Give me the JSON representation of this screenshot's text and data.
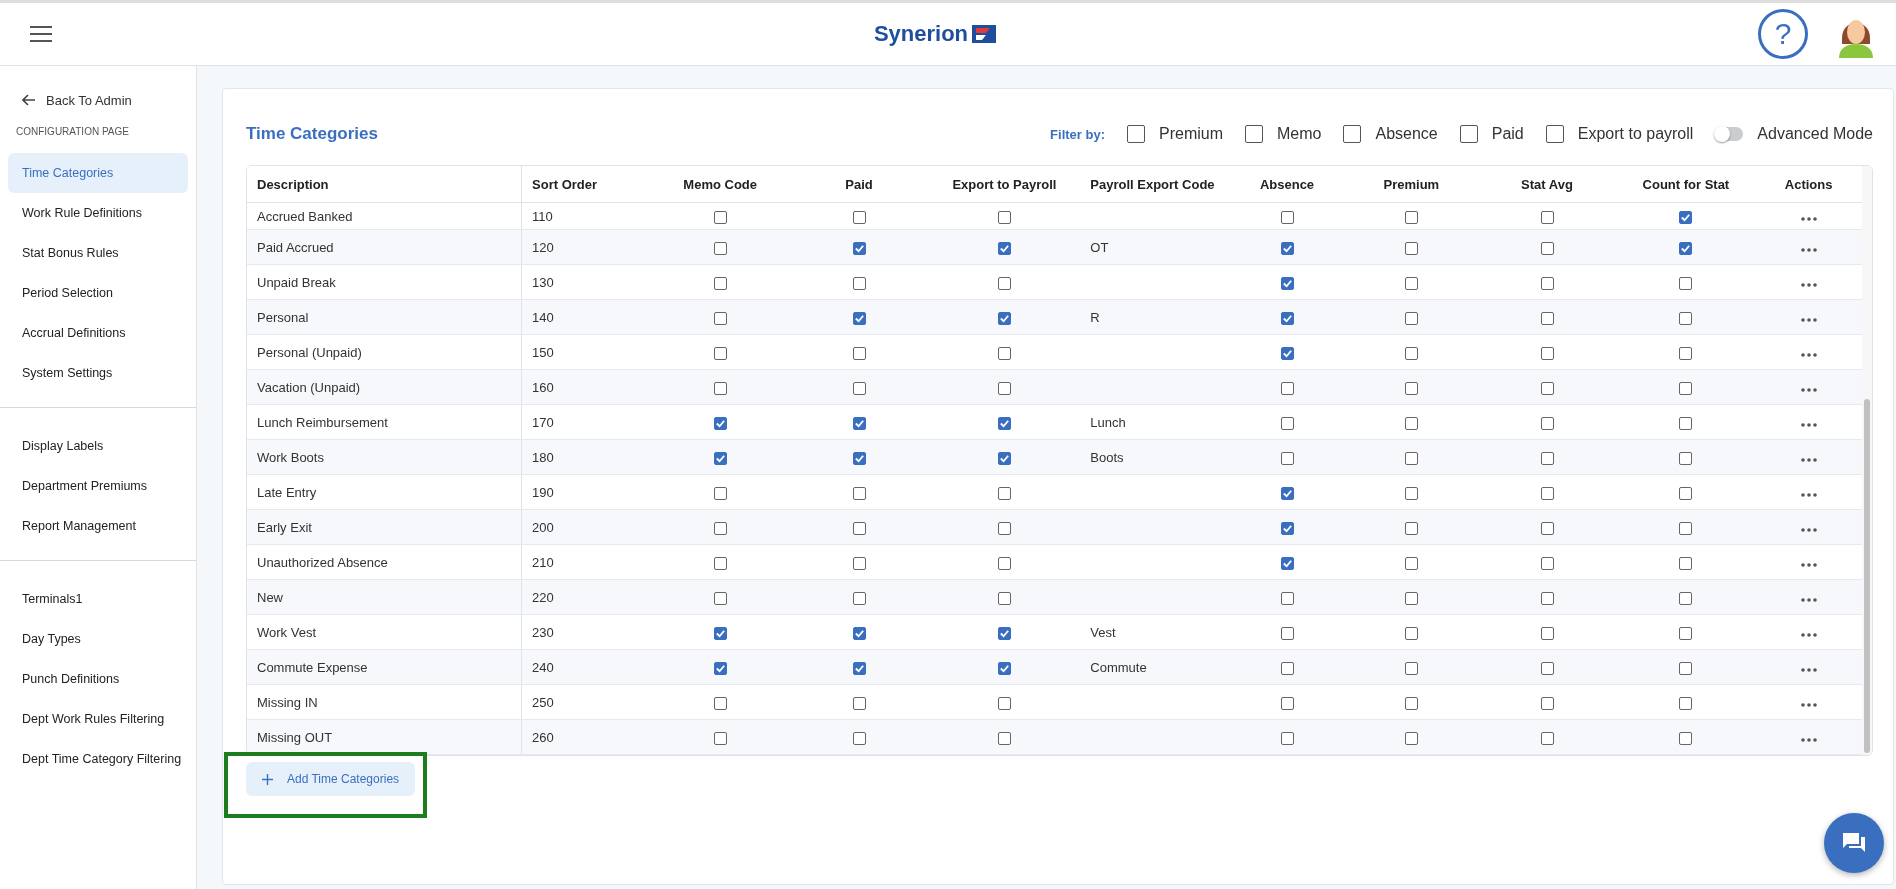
{
  "header": {
    "logo": "Synerion",
    "help_button": "?"
  },
  "sidebar": {
    "back_link": "Back To Admin",
    "section_title": "CONFIGURATION PAGE",
    "groups": [
      {
        "items": [
          {
            "label": "Time Categories",
            "selected": true
          },
          {
            "label": "Work Rule Definitions",
            "selected": false
          },
          {
            "label": "Stat Bonus Rules",
            "selected": false
          },
          {
            "label": "Period Selection",
            "selected": false
          },
          {
            "label": "Accrual Definitions",
            "selected": false
          },
          {
            "label": "System Settings",
            "selected": false
          }
        ]
      },
      {
        "items": [
          {
            "label": "Display Labels",
            "selected": false
          },
          {
            "label": "Department Premiums",
            "selected": false
          },
          {
            "label": "Report Management",
            "selected": false
          }
        ]
      },
      {
        "items": [
          {
            "label": "Terminals1",
            "selected": false
          },
          {
            "label": "Day Types",
            "selected": false
          },
          {
            "label": "Punch Definitions",
            "selected": false
          },
          {
            "label": "Dept Work Rules Filtering",
            "selected": false
          },
          {
            "label": "Dept Time Category Filtering",
            "selected": false
          }
        ]
      }
    ]
  },
  "page_title": "Time Categories",
  "filter": {
    "label": "Filter by:",
    "options": [
      {
        "label": "Premium",
        "checked": false
      },
      {
        "label": "Memo",
        "checked": false
      },
      {
        "label": "Absence",
        "checked": false
      },
      {
        "label": "Paid",
        "checked": false
      },
      {
        "label": "Export to payroll",
        "checked": false
      }
    ],
    "advanced_mode": {
      "label": "Advanced Mode",
      "on": false
    }
  },
  "table": {
    "columns": [
      "Description",
      "Sort Order",
      "Memo Code",
      "Paid",
      "Export to Payroll",
      "Payroll Export Code",
      "Absence",
      "Premium",
      "Stat Avg",
      "Count for Stat",
      "Actions"
    ],
    "rows": [
      {
        "description": "Accrued Banked",
        "sort_order": "110",
        "memo_code": false,
        "paid": false,
        "export_to_payroll": false,
        "absence": false,
        "premium": false,
        "stat_avg": false,
        "count_for_stat": true
      },
      {
        "description": "Paid Accrued",
        "sort_order": "120",
        "memo_code": false,
        "paid": true,
        "export_to_payroll": true,
        "payroll_export_code": "OT",
        "absence": true,
        "premium": false,
        "stat_avg": false,
        "count_for_stat": true
      },
      {
        "description": "Unpaid Break",
        "sort_order": "130",
        "memo_code": false,
        "paid": false,
        "export_to_payroll": false,
        "absence": true,
        "premium": false,
        "stat_avg": false,
        "count_for_stat": false
      },
      {
        "description": "Personal",
        "sort_order": "140",
        "memo_code": false,
        "paid": true,
        "export_to_payroll": true,
        "payroll_export_code": "R",
        "absence": true,
        "premium": false,
        "stat_avg": false,
        "count_for_stat": false
      },
      {
        "description": "Personal (Unpaid)",
        "sort_order": "150",
        "memo_code": false,
        "paid": false,
        "export_to_payroll": false,
        "absence": true,
        "premium": false,
        "stat_avg": false,
        "count_for_stat": false
      },
      {
        "description": "Vacation (Unpaid)",
        "sort_order": "160",
        "memo_code": false,
        "paid": false,
        "export_to_payroll": false,
        "absence": false,
        "premium": false,
        "stat_avg": false,
        "count_for_stat": false
      },
      {
        "description": "Lunch Reimbursement",
        "sort_order": "170",
        "memo_code": true,
        "paid": true,
        "export_to_payroll": true,
        "payroll_export_code": "Lunch",
        "absence": false,
        "premium": false,
        "stat_avg": false,
        "count_for_stat": false
      },
      {
        "description": "Work Boots",
        "sort_order": "180",
        "memo_code": true,
        "paid": true,
        "export_to_payroll": true,
        "payroll_export_code": "Boots",
        "absence": false,
        "premium": false,
        "stat_avg": false,
        "count_for_stat": false
      },
      {
        "description": "Late Entry",
        "sort_order": "190",
        "memo_code": false,
        "paid": false,
        "export_to_payroll": false,
        "absence": true,
        "premium": false,
        "stat_avg": false,
        "count_for_stat": false
      },
      {
        "description": "Early Exit",
        "sort_order": "200",
        "memo_code": false,
        "paid": false,
        "export_to_payroll": false,
        "absence": true,
        "premium": false,
        "stat_avg": false,
        "count_for_stat": false
      },
      {
        "description": "Unauthorized Absence",
        "sort_order": "210",
        "memo_code": false,
        "paid": false,
        "export_to_payroll": false,
        "absence": true,
        "premium": false,
        "stat_avg": false,
        "count_for_stat": false
      },
      {
        "description": "New",
        "sort_order": "220",
        "memo_code": false,
        "paid": false,
        "export_to_payroll": false,
        "absence": false,
        "premium": false,
        "stat_avg": false,
        "count_for_stat": false
      },
      {
        "description": "Work Vest",
        "sort_order": "230",
        "memo_code": true,
        "paid": true,
        "export_to_payroll": true,
        "payroll_export_code": "Vest",
        "absence": false,
        "premium": false,
        "stat_avg": false,
        "count_for_stat": false
      },
      {
        "description": "Commute Expense",
        "sort_order": "240",
        "memo_code": true,
        "paid": true,
        "export_to_payroll": true,
        "payroll_export_code": "Commute",
        "absence": false,
        "premium": false,
        "stat_avg": false,
        "count_for_stat": false
      },
      {
        "description": "Missing IN",
        "sort_order": "250",
        "memo_code": false,
        "paid": false,
        "export_to_payroll": false,
        "absence": false,
        "premium": false,
        "stat_avg": false,
        "count_for_stat": false
      },
      {
        "description": "Missing OUT",
        "sort_order": "260",
        "memo_code": false,
        "paid": false,
        "export_to_payroll": false,
        "absence": false,
        "premium": false,
        "stat_avg": false,
        "count_for_stat": false
      }
    ]
  },
  "add_button": "Add Time Categories"
}
